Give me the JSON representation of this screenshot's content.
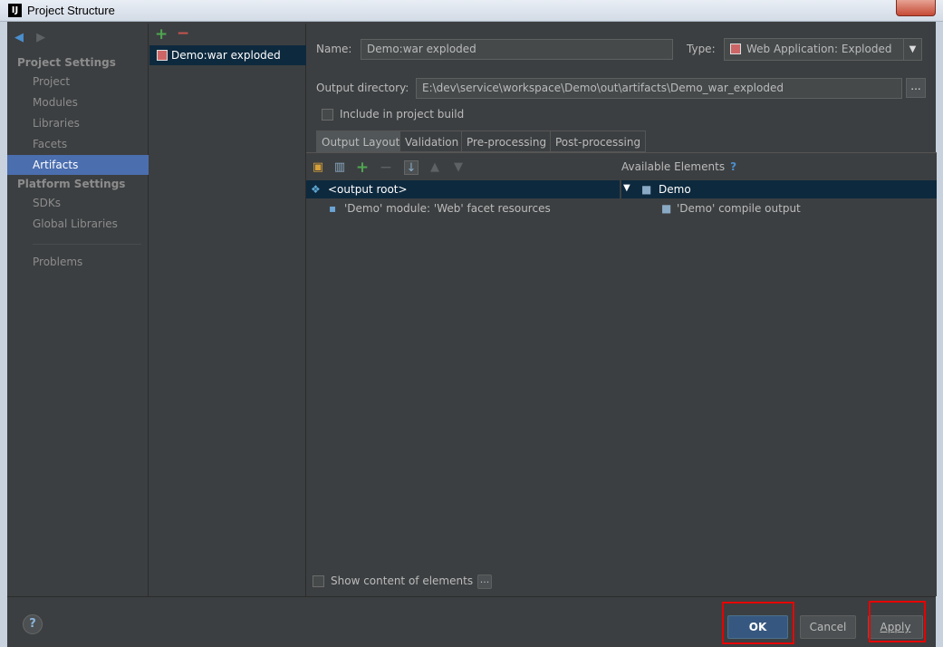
{
  "window": {
    "title": "Project Structure"
  },
  "nav": {
    "sections": [
      {
        "title": "Project Settings",
        "items": [
          "Project",
          "Modules",
          "Libraries",
          "Facets",
          "Artifacts"
        ]
      },
      {
        "title": "Platform Settings",
        "items": [
          "SDKs",
          "Global Libraries"
        ]
      }
    ],
    "problems": "Problems",
    "selected": "Artifacts"
  },
  "artifacts": {
    "add_icon": "+",
    "remove_icon": "−",
    "items": [
      "Demo:war exploded"
    ]
  },
  "form": {
    "name_label": "Name:",
    "name_value": "Demo:war exploded",
    "type_label": "Type:",
    "type_value": "Web Application: Exploded",
    "output_label": "Output directory:",
    "output_value": "E:\\dev\\service\\workspace\\Demo\\out\\artifacts\\Demo_war_exploded",
    "browse": "...",
    "include_build": "Include in project build"
  },
  "tabs": [
    "Output Layout",
    "Validation",
    "Pre-processing",
    "Post-processing"
  ],
  "layout": {
    "available_elements": "Available Elements",
    "help_mark": "?",
    "left_tree": [
      "<output root>",
      "'Demo' module: 'Web' facet resources"
    ],
    "right_tree": [
      "Demo",
      "'Demo' compile output"
    ],
    "show_content": "Show content of elements",
    "show_content_btn": "..."
  },
  "buttons": {
    "help": "?",
    "ok": "OK",
    "cancel": "Cancel",
    "apply": "Apply"
  },
  "colors": {
    "accent": "#4b6eaf",
    "selection": "#0d293e",
    "highlight_box": "#e60000"
  }
}
